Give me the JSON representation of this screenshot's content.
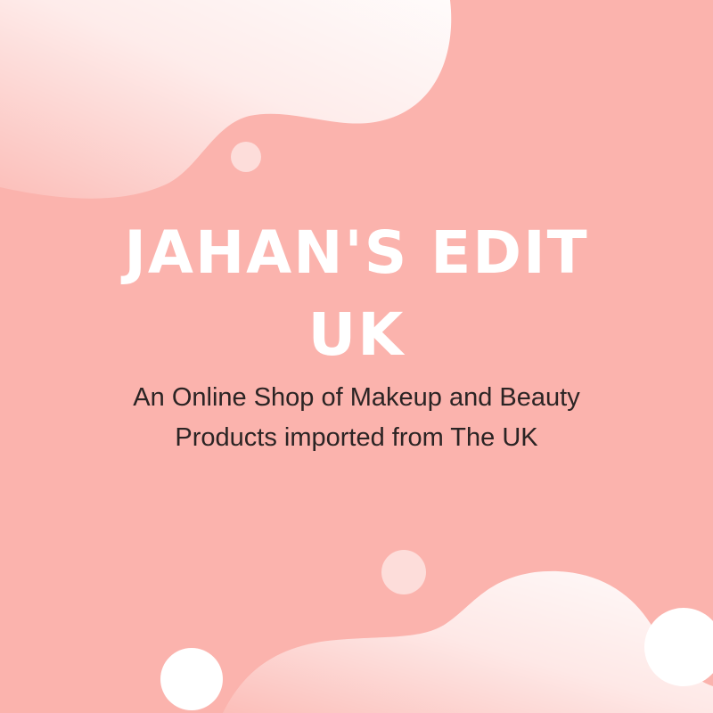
{
  "brand": {
    "title_line1": "JAHAN'S EDIT",
    "title_line2": "UK",
    "tagline_line1": "An Online Shop of Makeup and Beauty",
    "tagline_line2": "Products imported from The UK"
  },
  "colors": {
    "background": "#fbb3ad",
    "blob": "#ffffff",
    "title": "#ffffff",
    "tagline": "#2b2424"
  }
}
